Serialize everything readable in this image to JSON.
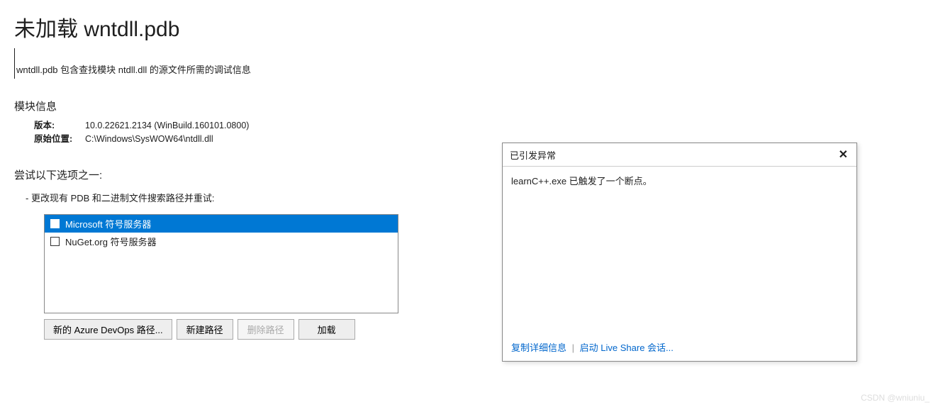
{
  "page_title": "未加载 wntdll.pdb",
  "description": "wntdll.pdb 包含查找模块 ntdll.dll 的源文件所需的调试信息",
  "module_info": {
    "header": "模块信息",
    "version_label": "版本:",
    "version_value": "10.0.22621.2134 (WinBuild.160101.0800)",
    "location_label": "原始位置:",
    "location_value": "C:\\Windows\\SysWOW64\\ntdll.dll"
  },
  "try_section": {
    "header": "尝试以下选项之一:",
    "bullet": "更改现有 PDB 和二进制文件搜索路径并重试:",
    "list": [
      {
        "label": "Microsoft 符号服务器",
        "selected": true
      },
      {
        "label": "NuGet.org 符号服务器",
        "selected": false
      }
    ],
    "buttons": {
      "new_azure": "新的 Azure DevOps 路径...",
      "new_path": "新建路径",
      "delete_path": "删除路径",
      "load": "加载"
    }
  },
  "exception_popup": {
    "title": "已引发异常",
    "message": "learnC++.exe 已触发了一个断点。",
    "copy_details": "复制详细信息",
    "live_share": "启动 Live Share 会话..."
  },
  "watermark": "CSDN @wniuniu_"
}
